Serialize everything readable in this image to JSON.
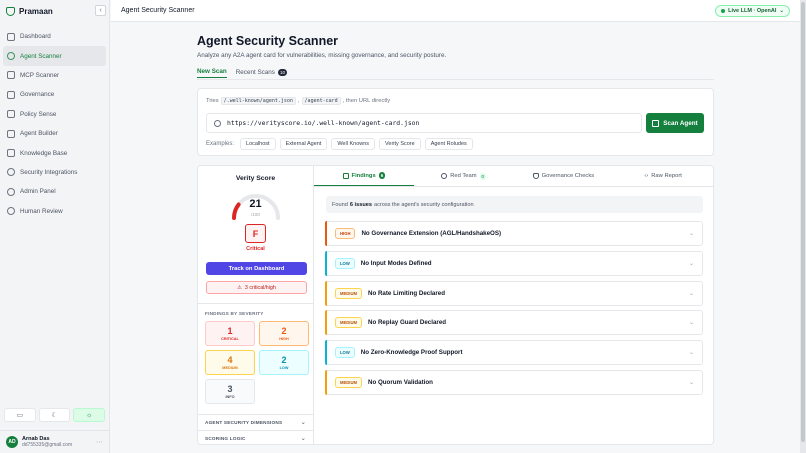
{
  "app": {
    "name": "Pramaan"
  },
  "sidebar": {
    "items": [
      {
        "label": "Dashboard",
        "active": false
      },
      {
        "label": "Agent Scanner",
        "active": true
      },
      {
        "label": "MCP Scanner",
        "active": false
      },
      {
        "label": "Governance",
        "active": false
      },
      {
        "label": "Policy Sense",
        "active": false
      },
      {
        "label": "Agent Builder",
        "active": false
      },
      {
        "label": "Knowledge Base",
        "active": false
      },
      {
        "label": "Security Integrations",
        "active": false
      },
      {
        "label": "Admin Panel",
        "active": false
      },
      {
        "label": "Human Review",
        "active": false
      }
    ]
  },
  "user": {
    "initials": "AD",
    "name": "Arnab Das",
    "email": "dd755335@gmail.com"
  },
  "topbar": {
    "title": "Agent Security Scanner",
    "llm_status": "Live LLM · OpenAI"
  },
  "header": {
    "title": "Agent Security Scanner",
    "subtitle": "Analyze any A2A agent card for vulnerabilities, missing governance, and security posture.",
    "tabs": [
      {
        "label": "New Scan",
        "active": true
      },
      {
        "label": "Recent Scans",
        "badge": "10",
        "active": false
      }
    ]
  },
  "scan": {
    "tries_prefix": "Tries",
    "path1": "/.well-known/agent.json",
    "sep": ",",
    "path2": "/agent-card",
    "tries_suffix": ", then URL directly",
    "url": "https://verityscore.io/.well-known/agent-card.json",
    "button": "Scan Agent",
    "examples_label": "Examples:",
    "examples": [
      "Localhost",
      "External Agent",
      "Well Knowns",
      "Verity Score",
      "Agent Roludes"
    ]
  },
  "score": {
    "title": "Verity Score",
    "value": "21",
    "out_of": "/100",
    "fraction": 0.21,
    "grade": "F",
    "grade_label": "Critical",
    "track_button": "Track on Dashboard",
    "critical_high": "3 critical/high",
    "severity_title": "FINDINGS BY SEVERITY",
    "severity": [
      {
        "count": "1",
        "label": "CRITICAL",
        "key": "critical"
      },
      {
        "count": "2",
        "label": "HIGH",
        "key": "high"
      },
      {
        "count": "4",
        "label": "MEDIUM",
        "key": "medium"
      },
      {
        "count": "2",
        "label": "LOW",
        "key": "low"
      },
      {
        "count": "3",
        "label": "INFO",
        "key": "info"
      }
    ],
    "dimensions_label": "AGENT SECURITY DIMENSIONS",
    "logic_label": "SCORING LOGIC"
  },
  "result_tabs": [
    {
      "label": "Findings",
      "badge": "6",
      "active": true
    },
    {
      "label": "Red Team",
      "badge": "0",
      "active": false
    },
    {
      "label": "Governance Checks",
      "active": false
    },
    {
      "label": "Raw Report",
      "active": false
    }
  ],
  "findings_summary": {
    "prefix": "Found",
    "count": "6 issues",
    "suffix": "across the agent's security configuration"
  },
  "findings": [
    {
      "severity": "HIGH",
      "title": "No Governance Extension (AGL/HandshakeOS)"
    },
    {
      "severity": "LOW",
      "title": "No Input Modes Defined"
    },
    {
      "severity": "MEDIUM",
      "title": "No Rate Limiting Declared"
    },
    {
      "severity": "MEDIUM",
      "title": "No Replay Guard Declared"
    },
    {
      "severity": "LOW",
      "title": "No Zero-Knowledge Proof Support"
    },
    {
      "severity": "MEDIUM",
      "title": "No Quorum Validation"
    }
  ],
  "colors": {
    "accent": "#15803d",
    "indigo": "#4f46e5",
    "critical": "#dc2626",
    "high": "#ea580c",
    "medium": "#d97706",
    "low": "#0891b2"
  }
}
